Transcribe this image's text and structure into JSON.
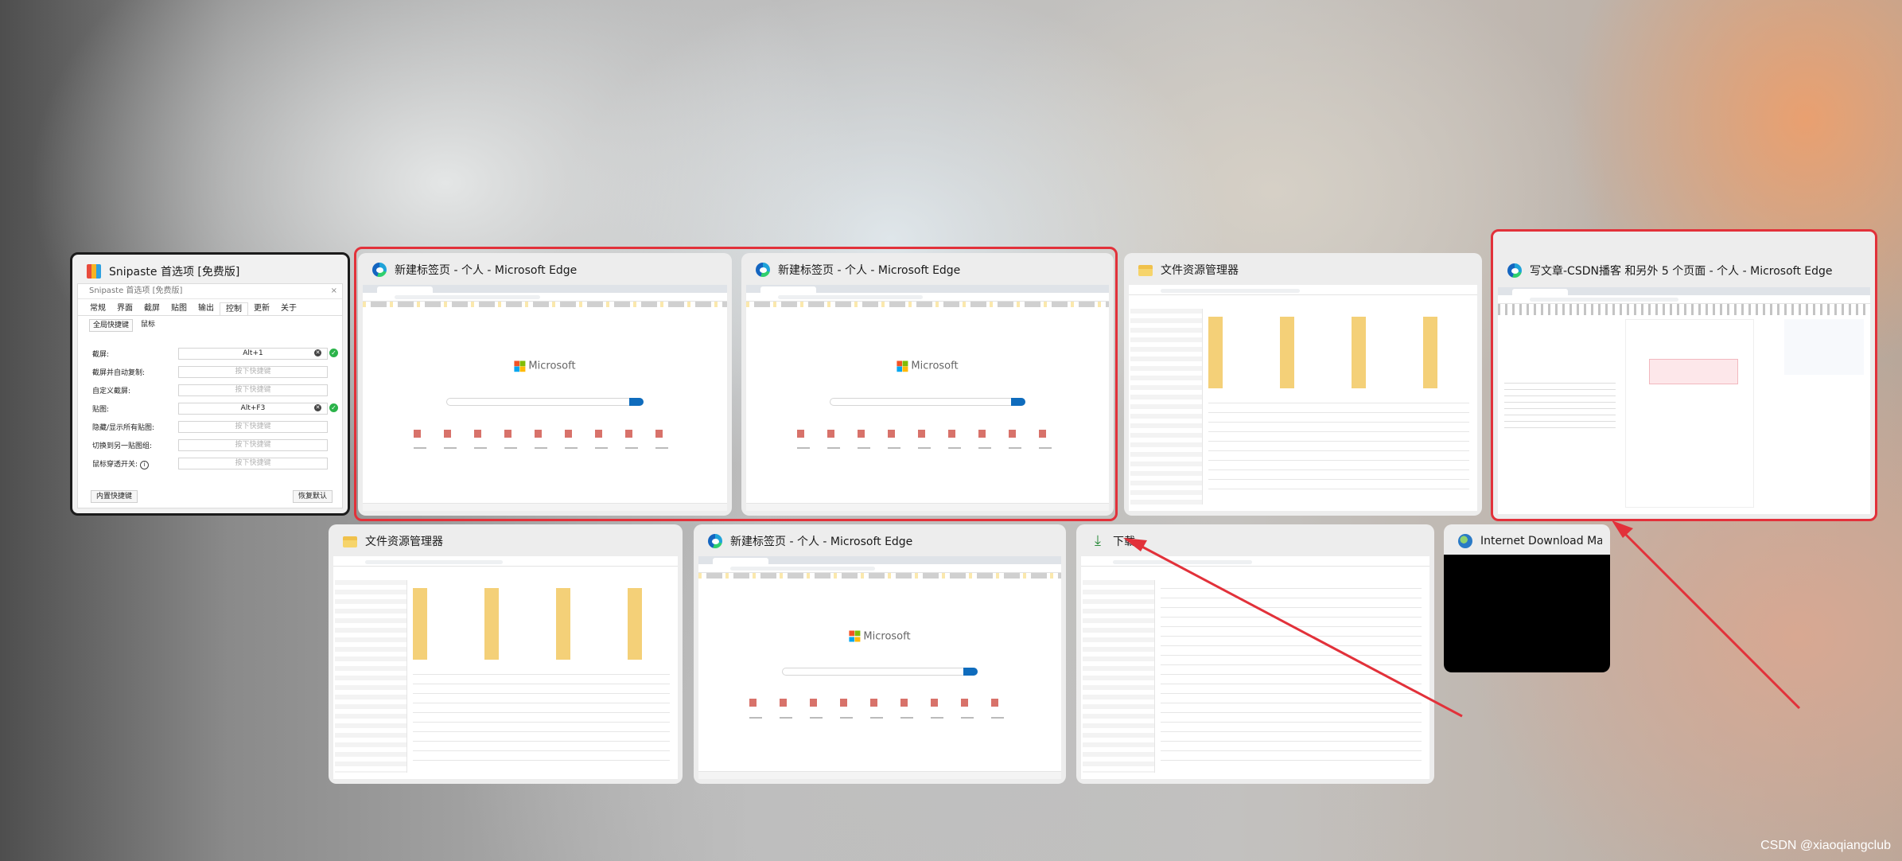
{
  "snipaste": {
    "window_title": "Snipaste 首选项 [免费版]",
    "dialog_title": "Snipaste 首选项 [免费版]",
    "close_glyph": "×",
    "tabs": [
      "常规",
      "界面",
      "截屏",
      "贴图",
      "输出",
      "控制",
      "更新",
      "关于"
    ],
    "selected_tab": "控制",
    "subtabs": [
      "全局快捷键",
      "鼠标"
    ],
    "rows": [
      {
        "label": "截屏:",
        "value": "Alt+1",
        "placeholder": false,
        "clear": true,
        "ok": true
      },
      {
        "label": "截屏并自动复制:",
        "value": "按下快捷键",
        "placeholder": true
      },
      {
        "label": "自定义截屏:",
        "value": "按下快捷键",
        "placeholder": true
      },
      {
        "label": "贴图:",
        "value": "Alt+F3",
        "placeholder": false,
        "clear": true,
        "ok": true
      },
      {
        "label": "隐藏/显示所有贴图:",
        "value": "按下快捷键",
        "placeholder": true
      },
      {
        "label": "切换到另一贴图组:",
        "value": "按下快捷键",
        "placeholder": true
      },
      {
        "label": "鼠标穿透开关:",
        "value": "按下快捷键",
        "placeholder": true,
        "info": true
      }
    ],
    "clear_glyph": "✕",
    "ok_glyph": "✓",
    "info_glyph": "i",
    "btn_builtin": "内置快捷键",
    "btn_restore": "恢复默认"
  },
  "windows": [
    {
      "title": "新建标签页 - 个人 - Microsoft Edge",
      "icon": "edge-icon"
    },
    {
      "title": "新建标签页 - 个人 - Microsoft Edge",
      "icon": "edge-icon"
    },
    {
      "title": "文件资源管理器",
      "icon": "folder-icon"
    },
    {
      "title": "写文章-CSDN播客 和另外 5 个页面 - 个人 - Microsoft Edge",
      "icon": "edge-icon"
    },
    {
      "title": "文件资源管理器",
      "icon": "folder-icon"
    },
    {
      "title": "新建标签页 - 个人 - Microsoft Edge",
      "icon": "edge-icon"
    },
    {
      "title": "下载",
      "icon": "download-icon"
    },
    {
      "title": "Internet Download Ma...",
      "icon": "idm-icon"
    }
  ],
  "thumb_text": {
    "microsoft": "Microsoft"
  },
  "watermark": "CSDN @xiaoqiangclub",
  "colors": {
    "highlight": "#e2313a",
    "active_border": "#1b1b1b"
  }
}
